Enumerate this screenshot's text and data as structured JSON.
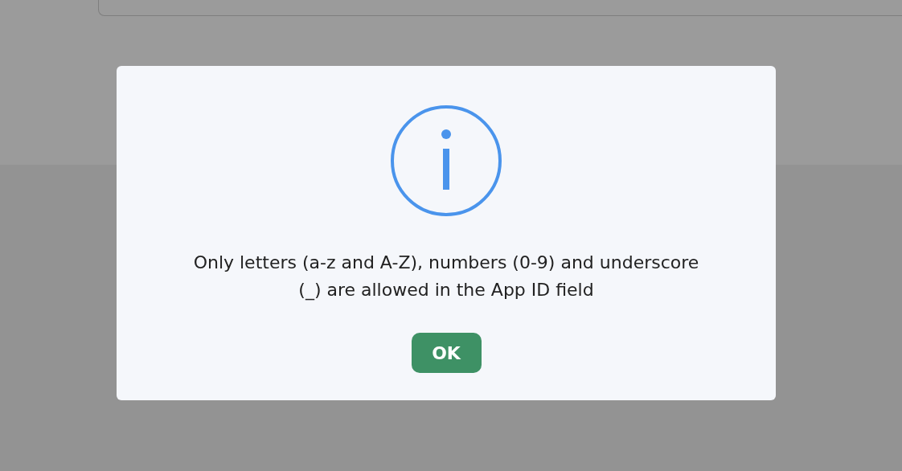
{
  "dialog": {
    "message": "Only letters (a-z and A-Z), numbers (0-9) and underscore (_) are allowed in the App ID field",
    "button": "OK"
  }
}
